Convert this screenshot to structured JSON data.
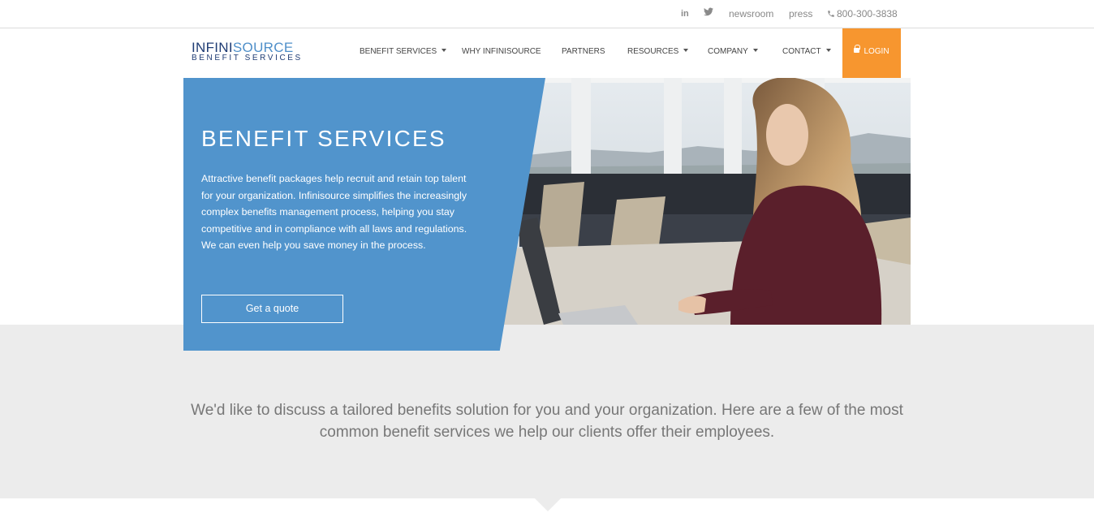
{
  "topbar": {
    "linkedin": "in",
    "twitter": "🐦",
    "newsroom": "newsroom",
    "press": "press",
    "phone": "800-300-3838"
  },
  "logo": {
    "line1_a": "INFINI",
    "line1_b": "SOURCE",
    "line2": "BENEFIT SERVICES"
  },
  "nav": {
    "items": [
      {
        "label": "BENEFIT SERVICES"
      },
      {
        "label": "WHY INFINISOURCE"
      },
      {
        "label": "PARTNERS"
      },
      {
        "label": "RESOURCES"
      },
      {
        "label": "COMPANY"
      },
      {
        "label": "CONTACT"
      }
    ],
    "login": "LOGIN"
  },
  "hero": {
    "title": "BENEFIT SERVICES",
    "body": "Attractive benefit packages help recruit and retain top talent for your organization. Infinisource simplifies the increasingly complex benefits management process, helping you stay competitive and in compliance with all laws and regulations. We can even help you save money in the process.",
    "cta": "Get a quote"
  },
  "intro": {
    "text": "We'd like to discuss a tailored benefits solution for you and your organization. Here are a few of the most common benefit services we help our clients offer their employees."
  },
  "colors": {
    "brand_blue": "#5194cc",
    "login_orange": "#f7962f",
    "logo_navy": "#1f3c74",
    "band_gray": "#ececec"
  }
}
